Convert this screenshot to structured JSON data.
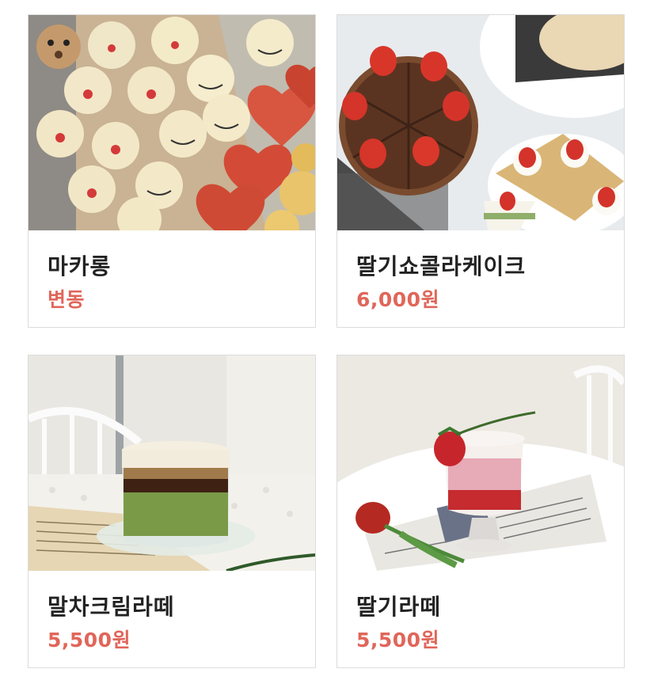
{
  "theme": {
    "price_color": "#e0665a",
    "name_color": "#222222",
    "border_color": "#dcdcdc"
  },
  "products": [
    {
      "name": "마카롱",
      "price": "변동",
      "photo": "macaron-photo"
    },
    {
      "name": "딸기쇼콜라케이크",
      "price": "6,000원",
      "photo": "strawberry-chocolate-cake-photo"
    },
    {
      "name": "말차크림라떼",
      "price": "5,500원",
      "photo": "matcha-cream-latte-photo"
    },
    {
      "name": "딸기라떼",
      "price": "5,500원",
      "photo": "strawberry-latte-photo"
    }
  ]
}
